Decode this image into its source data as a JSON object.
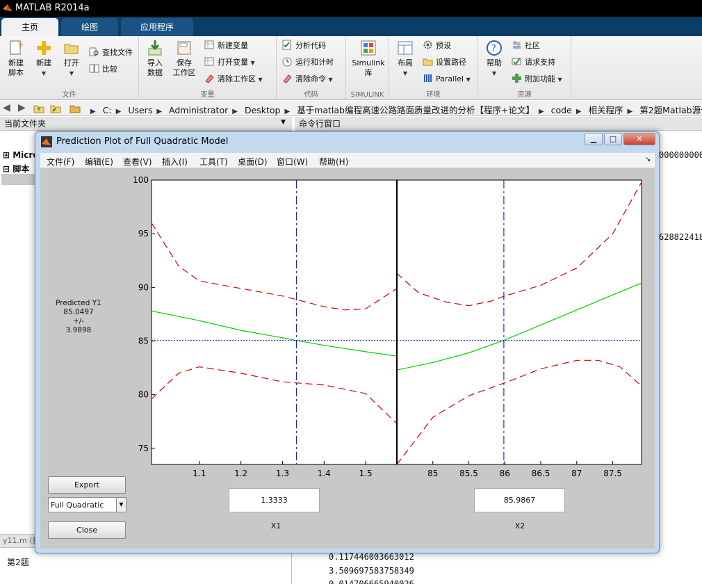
{
  "app": {
    "title": "MATLAB R2014a",
    "tabs": [
      {
        "label": "主页",
        "active": true
      },
      {
        "label": "绘图",
        "active": false
      },
      {
        "label": "应用程序",
        "active": false
      }
    ]
  },
  "ribbon": {
    "file": {
      "group_label": "文件",
      "new_script": "新建\n脚本",
      "new": "新建",
      "open": "打开",
      "find_files": "查找文件",
      "compare": "比较"
    },
    "variable": {
      "group_label": "变量",
      "import": "导入\n数据",
      "save_workspace": "保存\n工作区",
      "new_variable": "新建变量",
      "open_variable": "打开变量",
      "clear_workspace": "清除工作区"
    },
    "code": {
      "group_label": "代码",
      "analyze": "分析代码",
      "run_and_time": "运行和计时",
      "clear_commands": "清除命令"
    },
    "simulink": {
      "group_label": "SIMULINK",
      "library": "Simulink\n库"
    },
    "environment": {
      "group_label": "环境",
      "layout": "布局",
      "preferences": "预设",
      "set_path": "设置路径",
      "parallel": "Parallel"
    },
    "resources": {
      "group_label": "资源",
      "help": "帮助",
      "community": "社区",
      "request_support": "请求支持",
      "addons": "附加功能"
    }
  },
  "address": {
    "crumbs": [
      "C:",
      "Users",
      "Administrator",
      "Desktop",
      "基于matlab编程高速公路路面质量改进的分析【程序+论文】",
      "code",
      "相关程序",
      "第2题Matlab源代码"
    ]
  },
  "left_panel": {
    "header": "当前文件夹",
    "tree_item_1": "Micro",
    "tree_item_2": "脚本",
    "detail_file": "y11.m (脚",
    "detail_text": "第2题"
  },
  "command_window": {
    "header": "命令行窗口",
    "partial_1": "0000000000",
    "partial_2": "628822418",
    "line_1": "0.117446003663012",
    "line_2": "3.509697583758349",
    "line_3": "0.014706665940026"
  },
  "figure": {
    "title": "Prediction Plot of Full Quadratic Model",
    "menu": [
      "文件(F)",
      "编辑(E)",
      "查看(V)",
      "插入(I)",
      "工具(T)",
      "桌面(D)",
      "窗口(W)",
      "帮助(H)"
    ],
    "prediction": {
      "label": "Predicted Y1",
      "value": "85.0497",
      "pm": "+/-",
      "ci": "3.9898"
    },
    "export_label": "Export",
    "close_label": "Close",
    "model_select": "Full Quadratic",
    "x1_value": "1.3333",
    "x2_value": "85.9867",
    "x1_name": "X1",
    "x2_name": "X2"
  },
  "chart_data": [
    {
      "type": "line",
      "title": "",
      "xlabel": "X1",
      "ylabel": "",
      "xlim": [
        0.985,
        1.575
      ],
      "ylim": [
        73.5,
        100
      ],
      "xticks": [
        "1.1",
        "1.2",
        "1.3",
        "1.4",
        "1.5"
      ],
      "yticks": [
        "75",
        "80",
        "85",
        "90",
        "95",
        "100"
      ],
      "current_x": 1.3333,
      "current_y": 85.0497,
      "series": [
        {
          "x": [
            0.985,
            1.1,
            1.2,
            1.3,
            1.3333,
            1.4,
            1.5,
            1.575
          ],
          "y": [
            87.8,
            86.9,
            86.0,
            85.3,
            85.05,
            84.6,
            84.0,
            83.6
          ]
        },
        {
          "x": [
            0.985,
            1.05,
            1.1,
            1.2,
            1.3,
            1.4,
            1.45,
            1.5,
            1.575
          ],
          "y": [
            96.0,
            92.0,
            90.6,
            89.9,
            89.2,
            88.2,
            87.9,
            88.0,
            89.9
          ]
        },
        {
          "x": [
            0.985,
            1.05,
            1.1,
            1.2,
            1.3,
            1.4,
            1.5,
            1.575
          ],
          "y": [
            79.6,
            82.0,
            82.6,
            82.0,
            81.2,
            80.9,
            80.1,
            77.3
          ]
        }
      ],
      "colors": {
        "fit": "#00d000",
        "bounds": "#d00000",
        "crosshair": "#0000cc"
      }
    },
    {
      "type": "line",
      "title": "",
      "xlabel": "X2",
      "ylabel": "",
      "xlim": [
        84.5,
        87.9
      ],
      "ylim": [
        73.5,
        100
      ],
      "xticks": [
        "85",
        "85.5",
        "86",
        "86.5",
        "87",
        "87.5"
      ],
      "yticks": [],
      "current_x": 85.9867,
      "current_y": 85.0497,
      "series": [
        {
          "x": [
            84.5,
            85.0,
            85.5,
            86.0,
            86.5,
            87.0,
            87.5,
            87.9
          ],
          "y": [
            82.3,
            83.0,
            83.9,
            85.1,
            86.5,
            87.9,
            89.3,
            90.4
          ]
        },
        {
          "x": [
            84.5,
            84.8,
            85.2,
            85.5,
            85.8,
            86.0,
            86.5,
            87.0,
            87.5,
            87.9
          ],
          "y": [
            91.3,
            89.5,
            88.6,
            88.3,
            88.7,
            89.2,
            90.2,
            91.8,
            95.0,
            99.8
          ]
        },
        {
          "x": [
            84.5,
            85.0,
            85.5,
            86.0,
            86.5,
            87.0,
            87.3,
            87.6,
            87.9
          ],
          "y": [
            73.5,
            77.9,
            79.9,
            81.1,
            82.4,
            83.2,
            83.2,
            82.6,
            80.8
          ]
        }
      ],
      "colors": {
        "fit": "#00d000",
        "bounds": "#d00000",
        "crosshair": "#0000cc"
      }
    }
  ]
}
